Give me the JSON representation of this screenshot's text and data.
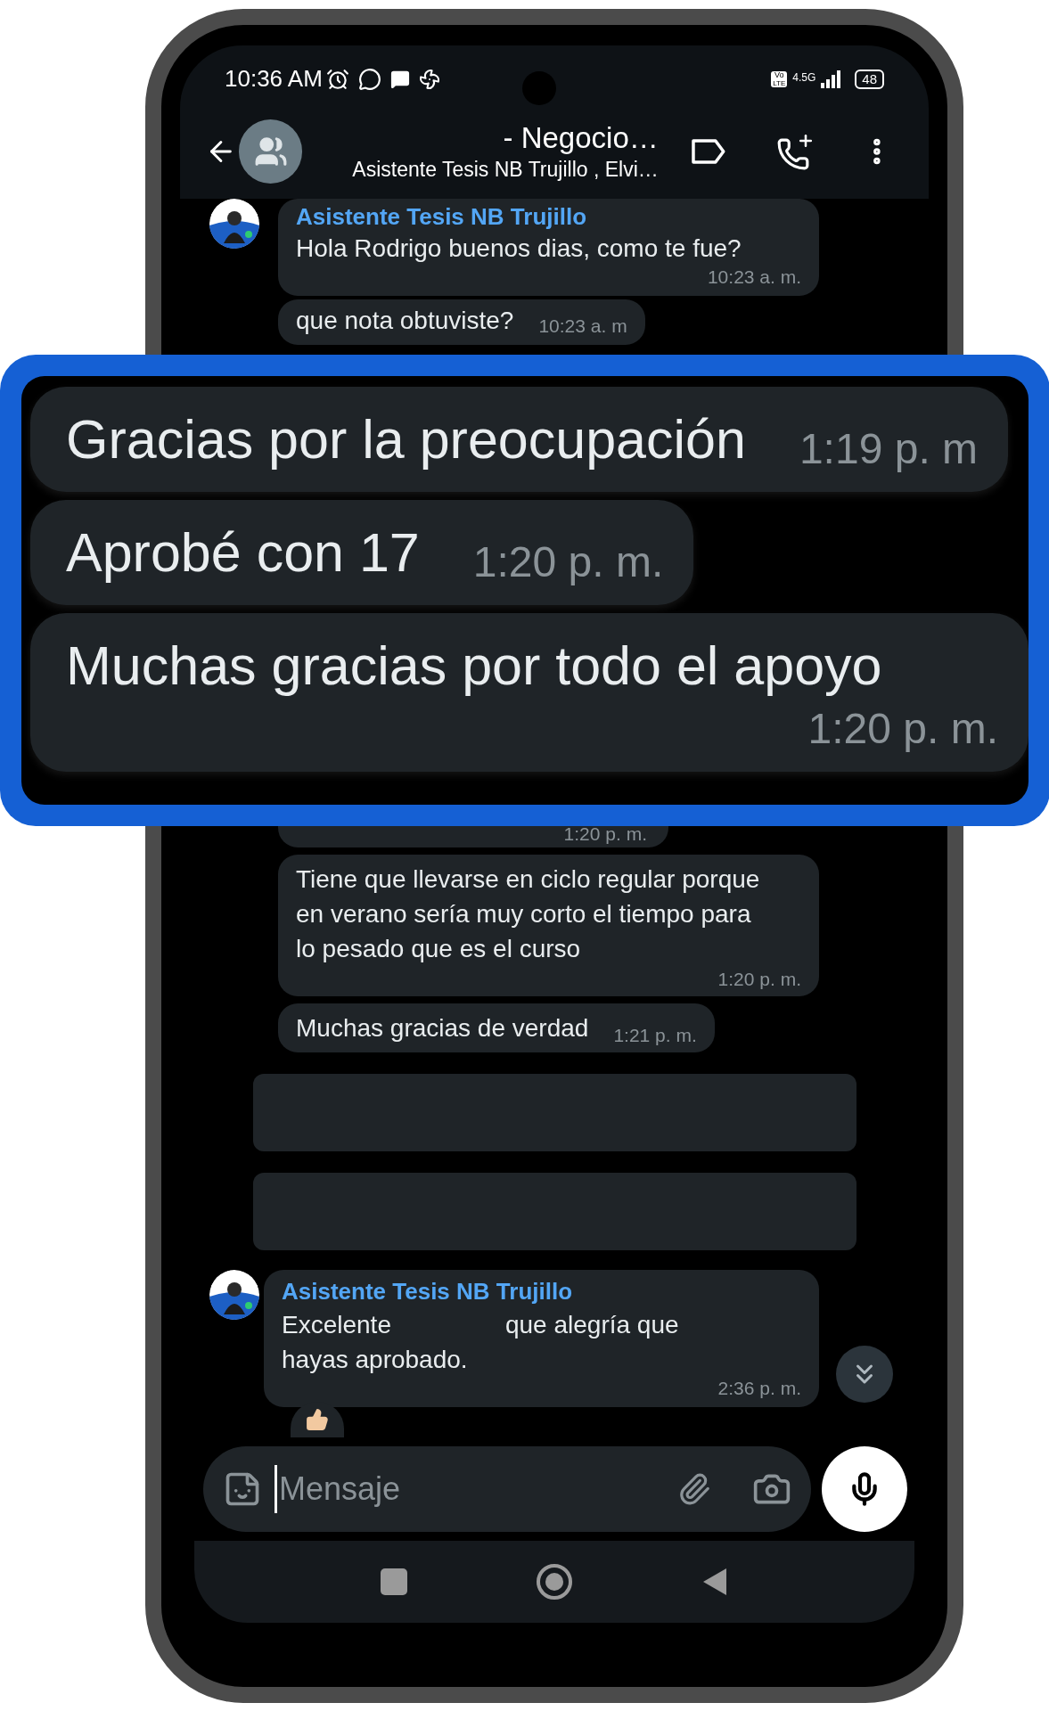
{
  "status_bar": {
    "time": "10:36 AM",
    "volte": [
      "Vo",
      "LTE"
    ],
    "network": "4.5G",
    "battery": "48"
  },
  "header": {
    "title": "- Negocio…",
    "subtitle": "Asistente Tesis NB Trujillo , Elvi…"
  },
  "messages_top": [
    {
      "sender": "Asistente Tesis NB Trujillo",
      "text": "Hola Rodrigo buenos dias, como te fue?",
      "time": "10:23 a. m."
    },
    {
      "text": "que nota obtuviste?",
      "time": "10:23 a. m"
    }
  ],
  "callout": {
    "messages": [
      {
        "text": "Gracias por la preocupación",
        "time": "1:19 p. m"
      },
      {
        "text": "Aprobé con 17",
        "time": "1:20 p. m."
      },
      {
        "text": "Muchas gracias por todo el apoyo",
        "time": "1:20 p. m."
      }
    ]
  },
  "messages_bottom": [
    {
      "kind": "cut",
      "time": "1:20 p. m."
    },
    {
      "kind": "text",
      "text": "Tiene que llevarse en ciclo regular porque en verano sería muy corto el tiempo para lo pesado que es el curso",
      "time": "1:20 p. m."
    },
    {
      "kind": "text",
      "text": "Muchas gracias de verdad",
      "time": "1:21 p. m."
    },
    {
      "kind": "redacted"
    },
    {
      "kind": "redacted"
    }
  ],
  "last_message": {
    "sender": "Asistente Tesis NB Trujillo",
    "text_parts": [
      "Excelente",
      "que alegría que hayas aprobado."
    ],
    "time": "2:36 p. m."
  },
  "composer": {
    "placeholder": "Mensaje"
  }
}
